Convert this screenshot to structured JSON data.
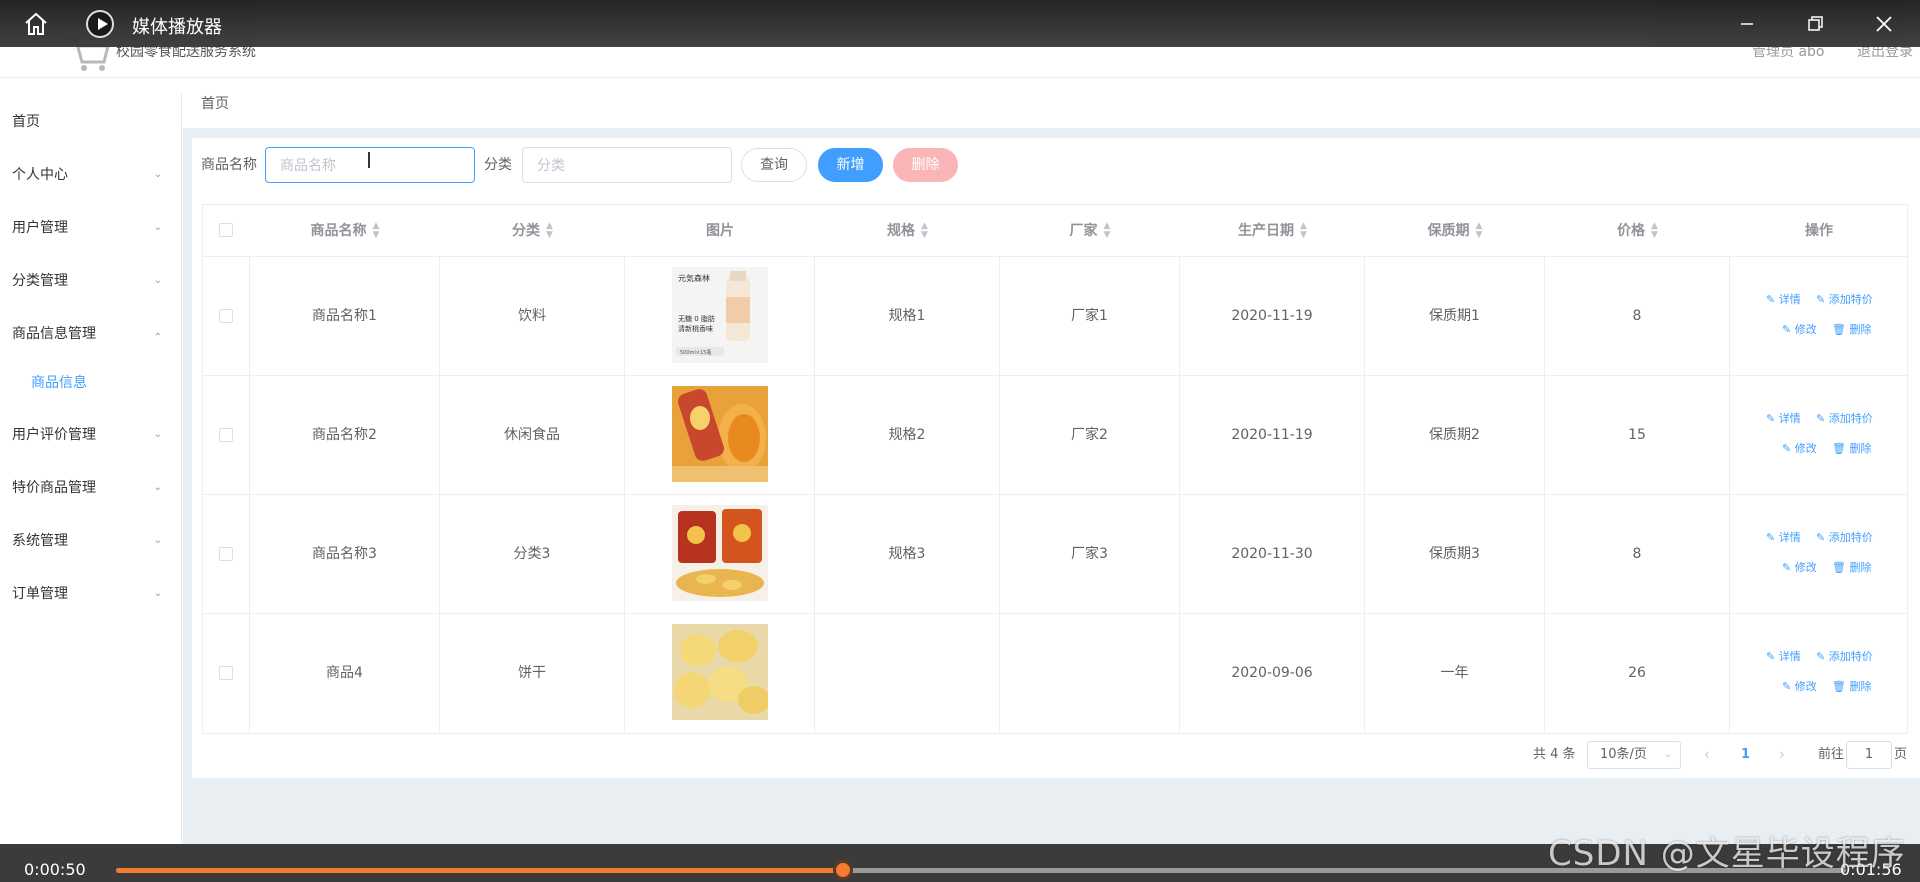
{
  "player": {
    "title": "媒体播放器",
    "current_time": "0:00:50",
    "total_time": "0:01:56",
    "progress": 0.42,
    "watermark": "CSDN @文星毕设程序"
  },
  "header": {
    "app_title": "校园零食配送服务系统",
    "admin": "管理员 abo",
    "logout": "退出登录"
  },
  "sidebar": {
    "items": [
      {
        "label": "首页",
        "expandable": false
      },
      {
        "label": "个人中心",
        "expandable": true
      },
      {
        "label": "用户管理",
        "expandable": true
      },
      {
        "label": "分类管理",
        "expandable": true
      },
      {
        "label": "商品信息管理",
        "expandable": true,
        "expanded": true
      },
      {
        "label": "用户评价管理",
        "expandable": true
      },
      {
        "label": "特价商品管理",
        "expandable": true
      },
      {
        "label": "系统管理",
        "expandable": true
      },
      {
        "label": "订单管理",
        "expandable": true
      }
    ],
    "sub_item": "商品信息"
  },
  "breadcrumb": "首页",
  "search": {
    "name_label": "商品名称",
    "name_placeholder": "商品名称",
    "category_label": "分类",
    "category_placeholder": "分类",
    "query_button": "查询",
    "add_button": "新增",
    "delete_button": "删除"
  },
  "table": {
    "headers": [
      "商品名称",
      "分类",
      "图片",
      "规格",
      "厂家",
      "生产日期",
      "保质期",
      "价格",
      "操作"
    ],
    "rows": [
      {
        "name": "商品名称1",
        "category": "饮料",
        "spec": "规格1",
        "maker": "厂家1",
        "date": "2020-11-19",
        "shelf": "保质期1",
        "price": "8",
        "img_text": [
          "元気森林",
          "无糖 0 脂肪",
          "清新桃香味",
          "500ml×15瓶"
        ]
      },
      {
        "name": "商品名称2",
        "category": "休闲食品",
        "spec": "规格2",
        "maker": "厂家2",
        "date": "2020-11-19",
        "shelf": "保质期2",
        "price": "15",
        "img_text": []
      },
      {
        "name": "商品名称3",
        "category": "分类3",
        "spec": "规格3",
        "maker": "厂家3",
        "date": "2020-11-30",
        "shelf": "保质期3",
        "price": "8",
        "img_text": []
      },
      {
        "name": "商品4",
        "category": "饼干",
        "spec": "",
        "maker": "",
        "date": "2020-09-06",
        "shelf": "一年",
        "price": "26",
        "img_text": []
      }
    ],
    "ops": {
      "detail": "详情",
      "special": "添加特价",
      "edit": "修改",
      "delete": "删除"
    }
  },
  "pagination": {
    "total": "共 4 条",
    "page_size": "10条/页",
    "current": "1",
    "goto_label": "前往",
    "goto_value": "1",
    "page_suffix": "页"
  },
  "colors": {
    "primary": "#409eff",
    "danger_light": "#fab6b6",
    "progress": "#f47c30"
  }
}
